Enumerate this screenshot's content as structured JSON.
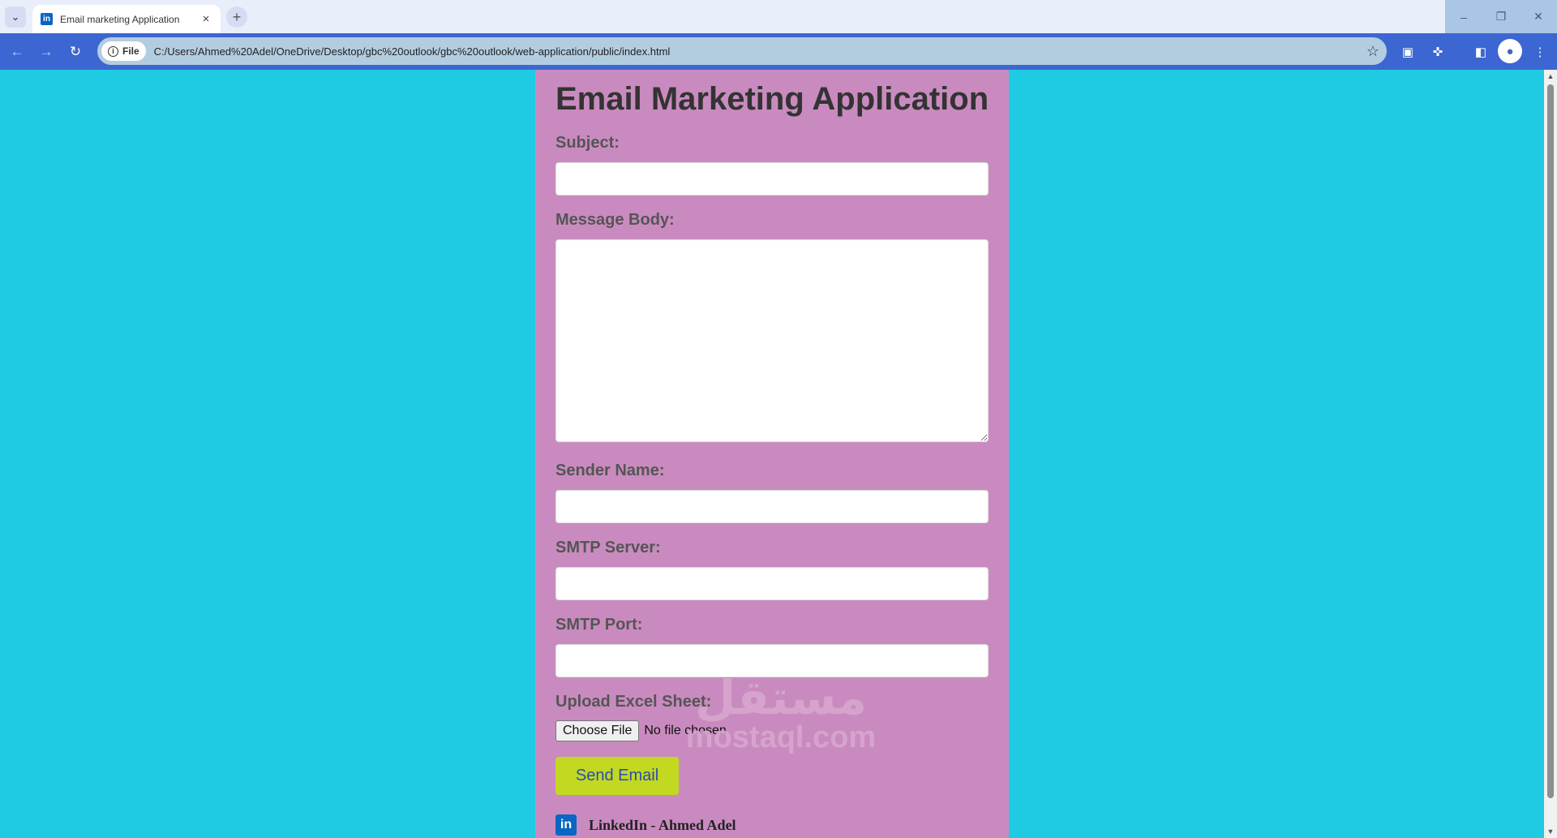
{
  "browser": {
    "tab_title": "Email marketing Application",
    "file_chip": "File",
    "url": "C:/Users/Ahmed%20Adel/OneDrive/Desktop/gbc%20outlook/gbc%20outlook/web-application/public/index.html",
    "icons": {
      "tab_search": "chevron-down-icon",
      "favicon": "linkedin-icon",
      "close": "close-icon",
      "new_tab": "plus-icon",
      "back": "arrow-left-icon",
      "forward": "arrow-right-icon",
      "reload": "reload-icon",
      "bookmark": "star-icon",
      "extensions": "puzzle-icon",
      "menu": "kebab-icon"
    }
  },
  "form": {
    "title": "Email Marketing Application",
    "subject_label": "Subject:",
    "message_label": "Message Body:",
    "sender_label": "Sender Name:",
    "smtp_server_label": "SMTP Server:",
    "smtp_port_label": "SMTP Port:",
    "upload_label": "Upload Excel Sheet:",
    "choose_file_label": "Choose File",
    "file_status": "No file chosen",
    "send_label": "Send Email",
    "footer_link": "LinkedIn - Ahmed Adel"
  },
  "watermark": {
    "arabic": "مستقل",
    "latin": "mostaql.com"
  },
  "colors": {
    "page_bg": "#1ecbe3",
    "card_bg": "#c98bbf",
    "send_button_bg": "#c3d820",
    "send_button_text": "#2a4db0",
    "toolbar": "#3c66d2"
  }
}
